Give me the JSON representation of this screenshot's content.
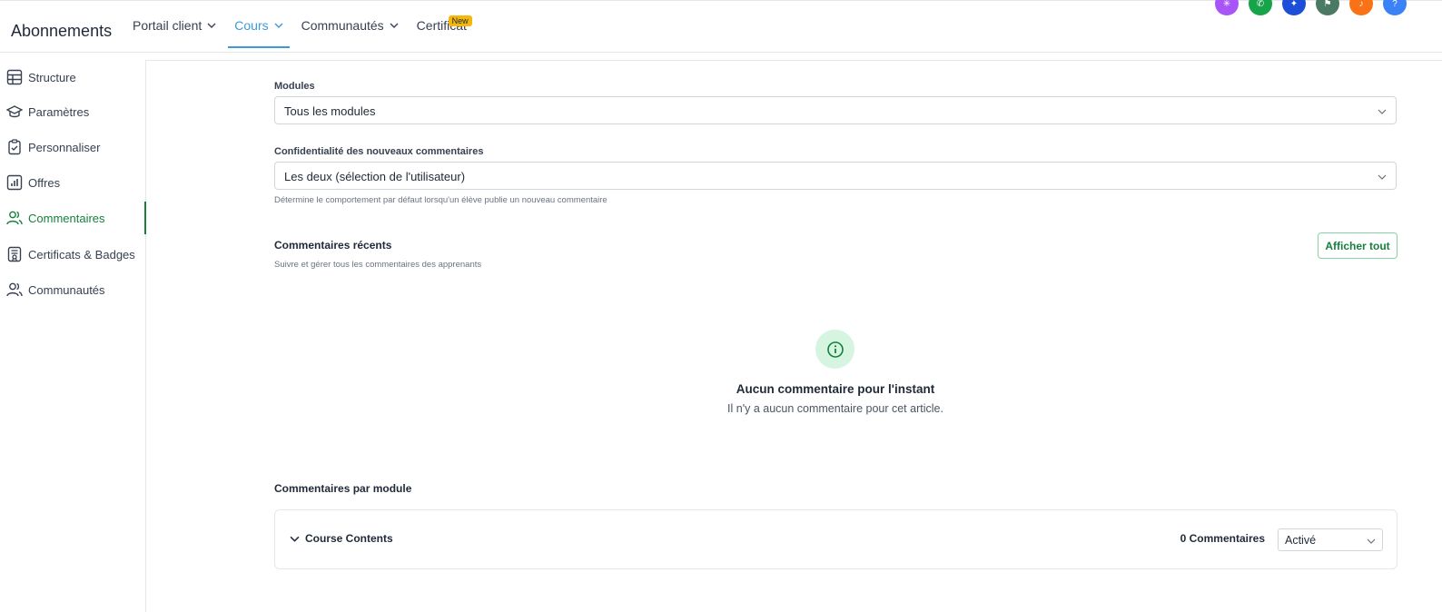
{
  "header": {
    "title": "Abonnements",
    "nav": [
      {
        "label": "Portail client"
      },
      {
        "label": "Cours"
      },
      {
        "label": "Communautés"
      },
      {
        "label": "Certificat",
        "badge": "New"
      }
    ]
  },
  "sidebar": {
    "items": [
      {
        "label": "Structure",
        "icon": "grid-icon"
      },
      {
        "label": "Paramètres",
        "icon": "graduation-cap-icon"
      },
      {
        "label": "Personnaliser",
        "icon": "clipboard-check-icon"
      },
      {
        "label": "Offres",
        "icon": "bar-chart-icon"
      },
      {
        "label": "Commentaires",
        "icon": "users-icon"
      },
      {
        "label": "Certificats & Badges",
        "icon": "certificate-icon"
      },
      {
        "label": "Communautés",
        "icon": "users-icon"
      }
    ]
  },
  "form": {
    "modules_label": "Modules",
    "modules_value": "Tous les modules",
    "privacy_label": "Confidentialité des nouveaux commentaires",
    "privacy_value": "Les deux (sélection de l'utilisateur)",
    "privacy_hint": "Détermine le comportement par défaut lorsqu'un élève publie un nouveau commentaire"
  },
  "recent": {
    "title": "Commentaires récents",
    "subtitle": "Suivre et gérer tous les commentaires des apprenants",
    "show_all": "Afficher tout",
    "empty_title": "Aucun commentaire pour l'instant",
    "empty_sub": "Il n'y a aucun commentaire pour cet article."
  },
  "by_module": {
    "title": "Commentaires par module",
    "modules": [
      {
        "name": "Course Contents",
        "count": "0 Commentaires",
        "status": "Activé"
      }
    ]
  },
  "colors": {
    "accent_green": "#16803c",
    "accent_blue": "#3b9bd8",
    "badge_yellow": "#f5b70a"
  }
}
